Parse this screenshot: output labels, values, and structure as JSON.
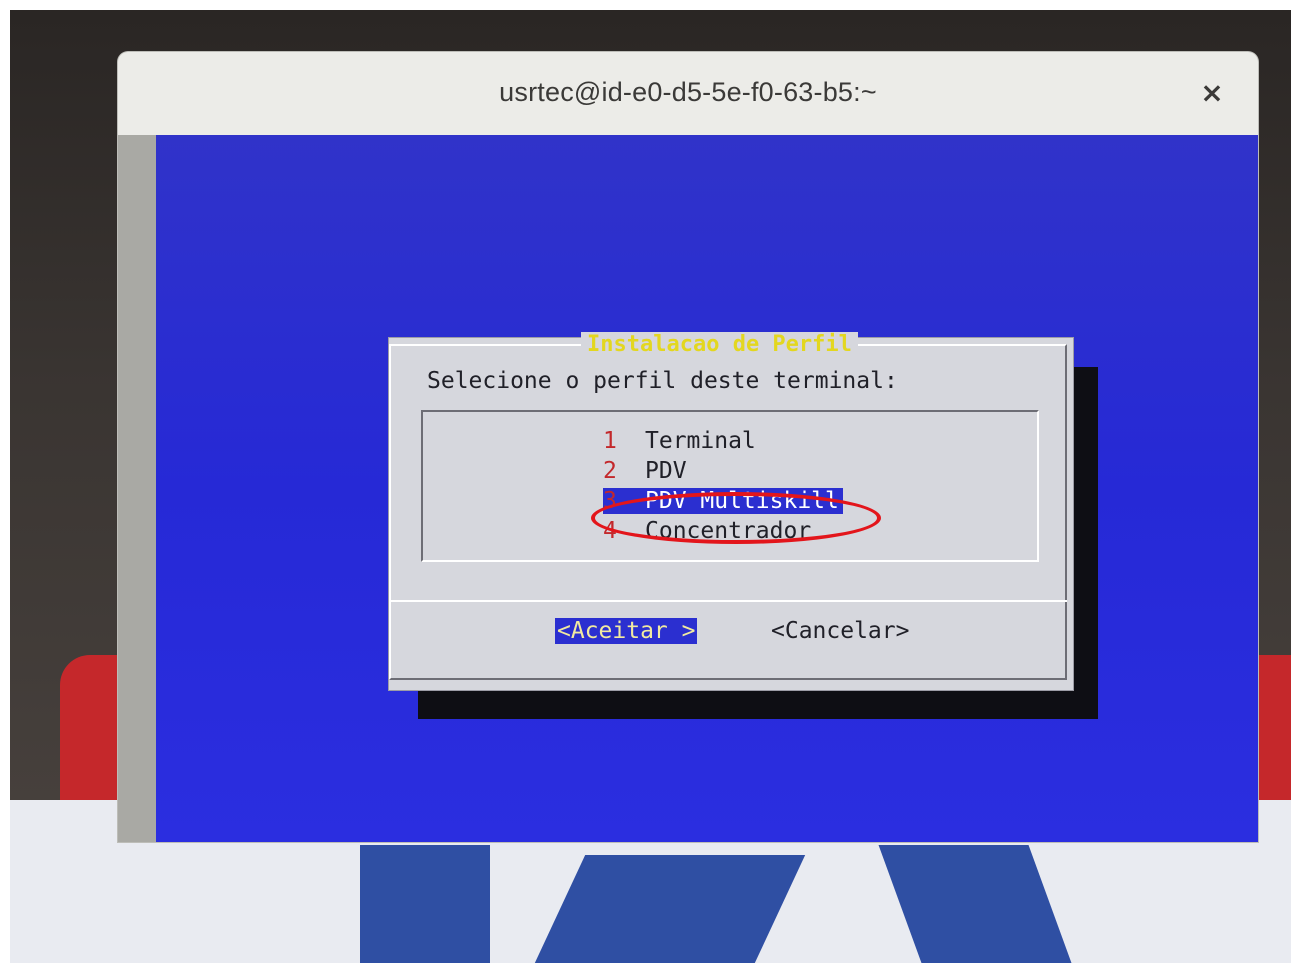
{
  "window": {
    "title": "usrtec@id-e0-d5-5e-f0-63-b5:~",
    "close_glyph": "×"
  },
  "dialog": {
    "title": "Instalacao de Perfil",
    "prompt": "Selecione o perfil deste terminal:",
    "items": [
      {
        "num": "1",
        "label": "Terminal",
        "selected": false
      },
      {
        "num": "2",
        "label": "PDV",
        "selected": false
      },
      {
        "num": "3",
        "label": "PDV Multiskill",
        "selected": true
      },
      {
        "num": "4",
        "label": "Concentrador",
        "selected": false
      }
    ],
    "accept_label": "<Aceitar >",
    "cancel_label": "<Cancelar>"
  },
  "colors": {
    "terminal_bg": "#2b2fd0",
    "dialog_bg": "#d6d7dd",
    "title_yellow": "#e3d71f",
    "item_number_red": "#c3282b",
    "annotation_red": "#e3151b"
  },
  "icons": {
    "close": "close-icon"
  }
}
